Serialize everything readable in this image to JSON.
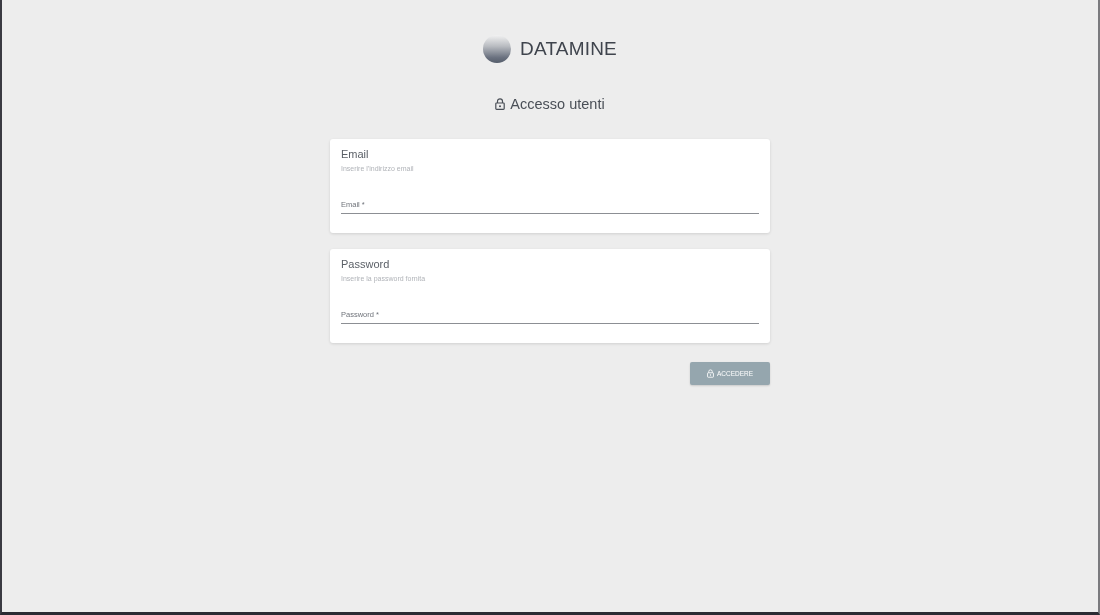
{
  "logo": {
    "name": "DATAMINE"
  },
  "heading": {
    "title": "Accesso utenti"
  },
  "fields": [
    {
      "title": "Email",
      "hint": "Inserire l'indirizzo email",
      "placeholder": "Email *"
    },
    {
      "title": "Password",
      "hint": "Inserire la password fornita",
      "placeholder": "Password *"
    }
  ],
  "submit_button": {
    "label": "ACCEDERE",
    "disabled": true
  }
}
